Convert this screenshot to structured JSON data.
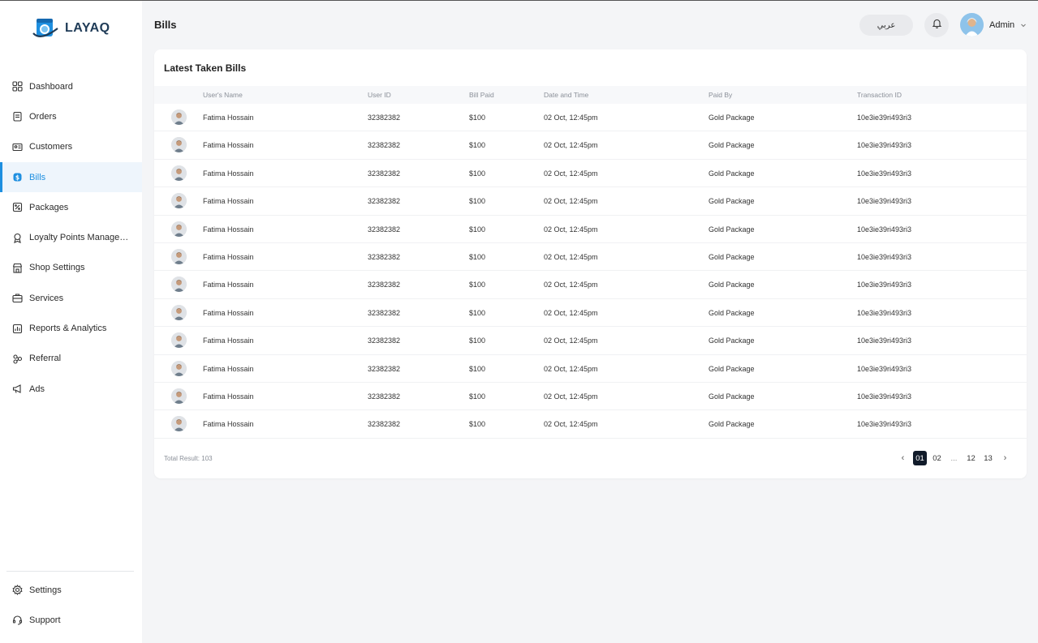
{
  "brand": {
    "name": "LAYAQ",
    "accent": "#1e8fe0"
  },
  "sidebar": {
    "items": [
      {
        "label": "Dashboard",
        "icon": "grid-icon"
      },
      {
        "label": "Orders",
        "icon": "clipboard-icon"
      },
      {
        "label": "Customers",
        "icon": "id-card-icon"
      },
      {
        "label": "Bills",
        "icon": "dollar-icon",
        "active": true
      },
      {
        "label": "Packages",
        "icon": "percent-tag-icon"
      },
      {
        "label": "Loyalty Points Management",
        "icon": "award-icon"
      },
      {
        "label": "Shop Settings",
        "icon": "shop-icon"
      },
      {
        "label": "Services",
        "icon": "briefcase-icon"
      },
      {
        "label": "Reports & Analytics",
        "icon": "chart-icon"
      },
      {
        "label": "Referral",
        "icon": "network-icon"
      },
      {
        "label": "Ads",
        "icon": "megaphone-icon"
      }
    ],
    "bottom": [
      {
        "label": "Settings",
        "icon": "gear-icon"
      },
      {
        "label": "Support",
        "icon": "headset-icon"
      }
    ]
  },
  "header": {
    "title": "Bills",
    "language_label": "عربي",
    "user_name": "Admin"
  },
  "card": {
    "title": "Latest Taken Bills",
    "columns": [
      "User's Name",
      "User ID",
      "Bill Paid",
      "Date and Time",
      "Paid By",
      "Transaction ID"
    ],
    "rows": [
      {
        "name": "Fatima Hossain",
        "user_id": "32382382",
        "bill": "$100",
        "date": "02 Oct, 12:45pm",
        "paid_by": "Gold Package",
        "tx": "10e3ie39ri493ri3"
      },
      {
        "name": "Fatima Hossain",
        "user_id": "32382382",
        "bill": "$100",
        "date": "02 Oct, 12:45pm",
        "paid_by": "Gold Package",
        "tx": "10e3ie39ri493ri3"
      },
      {
        "name": "Fatima Hossain",
        "user_id": "32382382",
        "bill": "$100",
        "date": "02 Oct, 12:45pm",
        "paid_by": "Gold Package",
        "tx": "10e3ie39ri493ri3"
      },
      {
        "name": "Fatima Hossain",
        "user_id": "32382382",
        "bill": "$100",
        "date": "02 Oct, 12:45pm",
        "paid_by": "Gold Package",
        "tx": "10e3ie39ri493ri3"
      },
      {
        "name": "Fatima Hossain",
        "user_id": "32382382",
        "bill": "$100",
        "date": "02 Oct, 12:45pm",
        "paid_by": "Gold Package",
        "tx": "10e3ie39ri493ri3"
      },
      {
        "name": "Fatima Hossain",
        "user_id": "32382382",
        "bill": "$100",
        "date": "02 Oct, 12:45pm",
        "paid_by": "Gold Package",
        "tx": "10e3ie39ri493ri3"
      },
      {
        "name": "Fatima Hossain",
        "user_id": "32382382",
        "bill": "$100",
        "date": "02 Oct, 12:45pm",
        "paid_by": "Gold Package",
        "tx": "10e3ie39ri493ri3"
      },
      {
        "name": "Fatima Hossain",
        "user_id": "32382382",
        "bill": "$100",
        "date": "02 Oct, 12:45pm",
        "paid_by": "Gold Package",
        "tx": "10e3ie39ri493ri3"
      },
      {
        "name": "Fatima Hossain",
        "user_id": "32382382",
        "bill": "$100",
        "date": "02 Oct, 12:45pm",
        "paid_by": "Gold Package",
        "tx": "10e3ie39ri493ri3"
      },
      {
        "name": "Fatima Hossain",
        "user_id": "32382382",
        "bill": "$100",
        "date": "02 Oct, 12:45pm",
        "paid_by": "Gold Package",
        "tx": "10e3ie39ri493ri3"
      },
      {
        "name": "Fatima Hossain",
        "user_id": "32382382",
        "bill": "$100",
        "date": "02 Oct, 12:45pm",
        "paid_by": "Gold Package",
        "tx": "10e3ie39ri493ri3"
      },
      {
        "name": "Fatima Hossain",
        "user_id": "32382382",
        "bill": "$100",
        "date": "02 Oct, 12:45pm",
        "paid_by": "Gold Package",
        "tx": "10e3ie39ri493ri3"
      }
    ],
    "total_label": "Total Result: 103",
    "pagination": {
      "prev": "‹",
      "next": "›",
      "pages": [
        "01",
        "02",
        "...",
        "12",
        "13"
      ],
      "current": "01"
    }
  }
}
